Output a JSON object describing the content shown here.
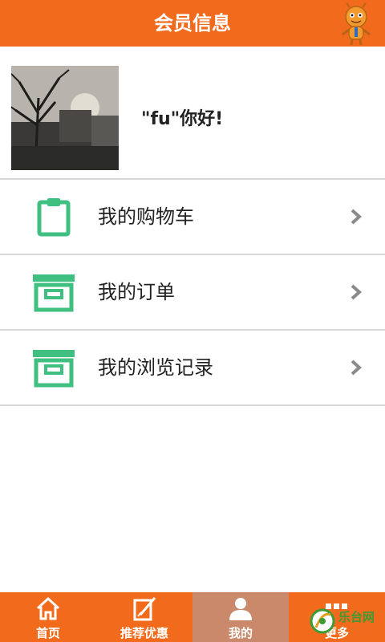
{
  "header": {
    "title": "会员信息"
  },
  "profile": {
    "greeting": "\"fu\"你好!"
  },
  "menu": {
    "items": [
      {
        "label": "我的购物车",
        "icon": "clipboard-icon"
      },
      {
        "label": "我的订单",
        "icon": "box-icon"
      },
      {
        "label": "我的浏览记录",
        "icon": "box-icon"
      }
    ]
  },
  "tabbar": {
    "tabs": [
      {
        "label": "首页",
        "icon": "home-icon"
      },
      {
        "label": "推荐优惠",
        "icon": "edit-icon"
      },
      {
        "label": "我的",
        "icon": "user-icon",
        "active": true
      },
      {
        "label": "更多",
        "icon": "more-icon"
      }
    ]
  },
  "watermark": {
    "text": "乐台网"
  },
  "colors": {
    "accent": "#f26b1d",
    "icon_green": "#3fbf80",
    "active_tab": "#c9896a"
  }
}
